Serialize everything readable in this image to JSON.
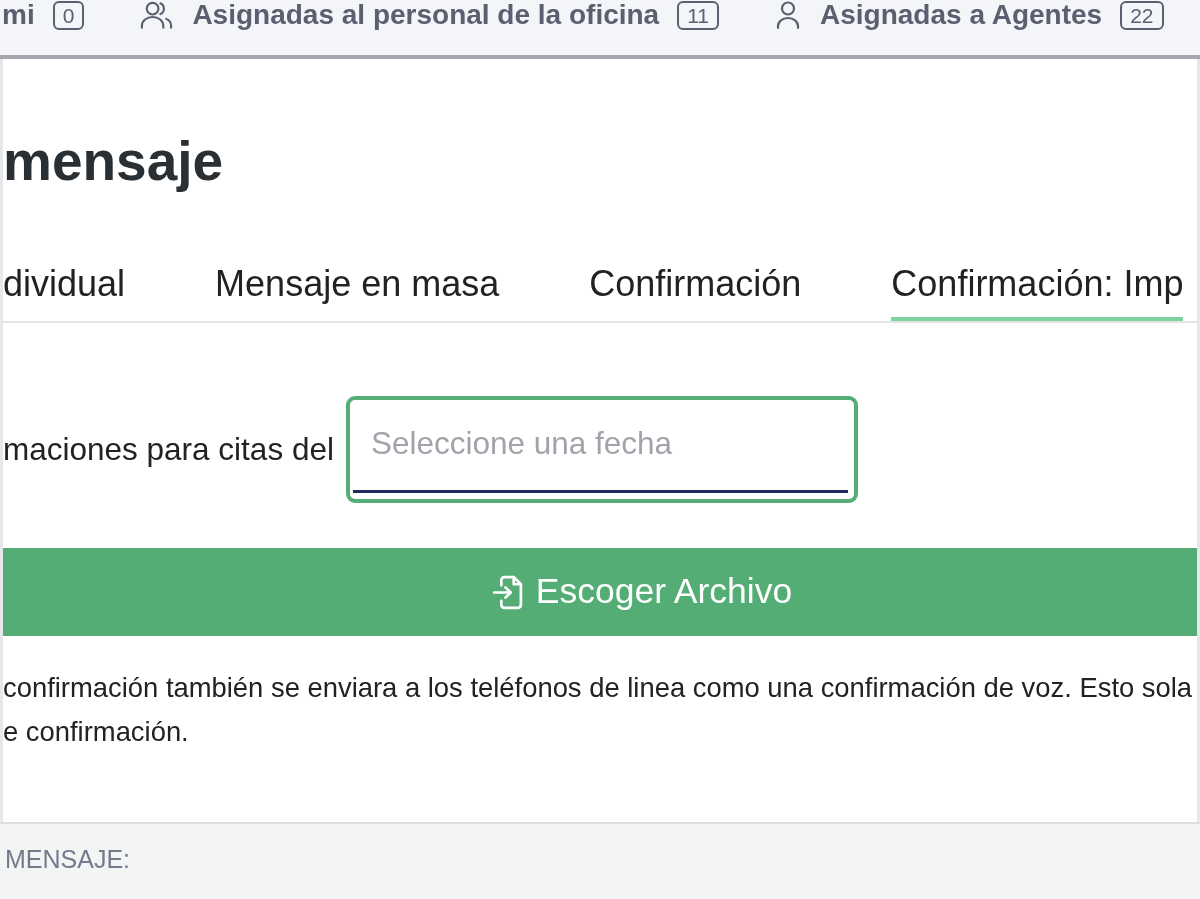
{
  "filter_tabs": [
    {
      "label": "mi",
      "count": "0"
    },
    {
      "kind": "group",
      "label": "Asignadas al personal de la oficina",
      "count": "11"
    },
    {
      "kind": "person",
      "label": "Asignadas a Agentes",
      "count": "22"
    }
  ],
  "page_title": "mensaje",
  "tabs": [
    {
      "label": "dividual",
      "selected": false
    },
    {
      "label": "Mensaje en masa",
      "selected": false
    },
    {
      "label": "Confirmación",
      "selected": false
    },
    {
      "label": "Confirmación: Imp",
      "selected": true
    }
  ],
  "date_filter": {
    "label": "maciones para citas del",
    "placeholder": "Seleccione una fecha",
    "focused": true
  },
  "upload_button": {
    "label": "Escoger Archivo"
  },
  "note": {
    "lines": [
      "confirmación también se enviara a los teléfonos de linea como una confirmación de voz. Esto sola",
      "e confirmación."
    ]
  },
  "footer": {
    "label": "MENSAJE:"
  }
}
